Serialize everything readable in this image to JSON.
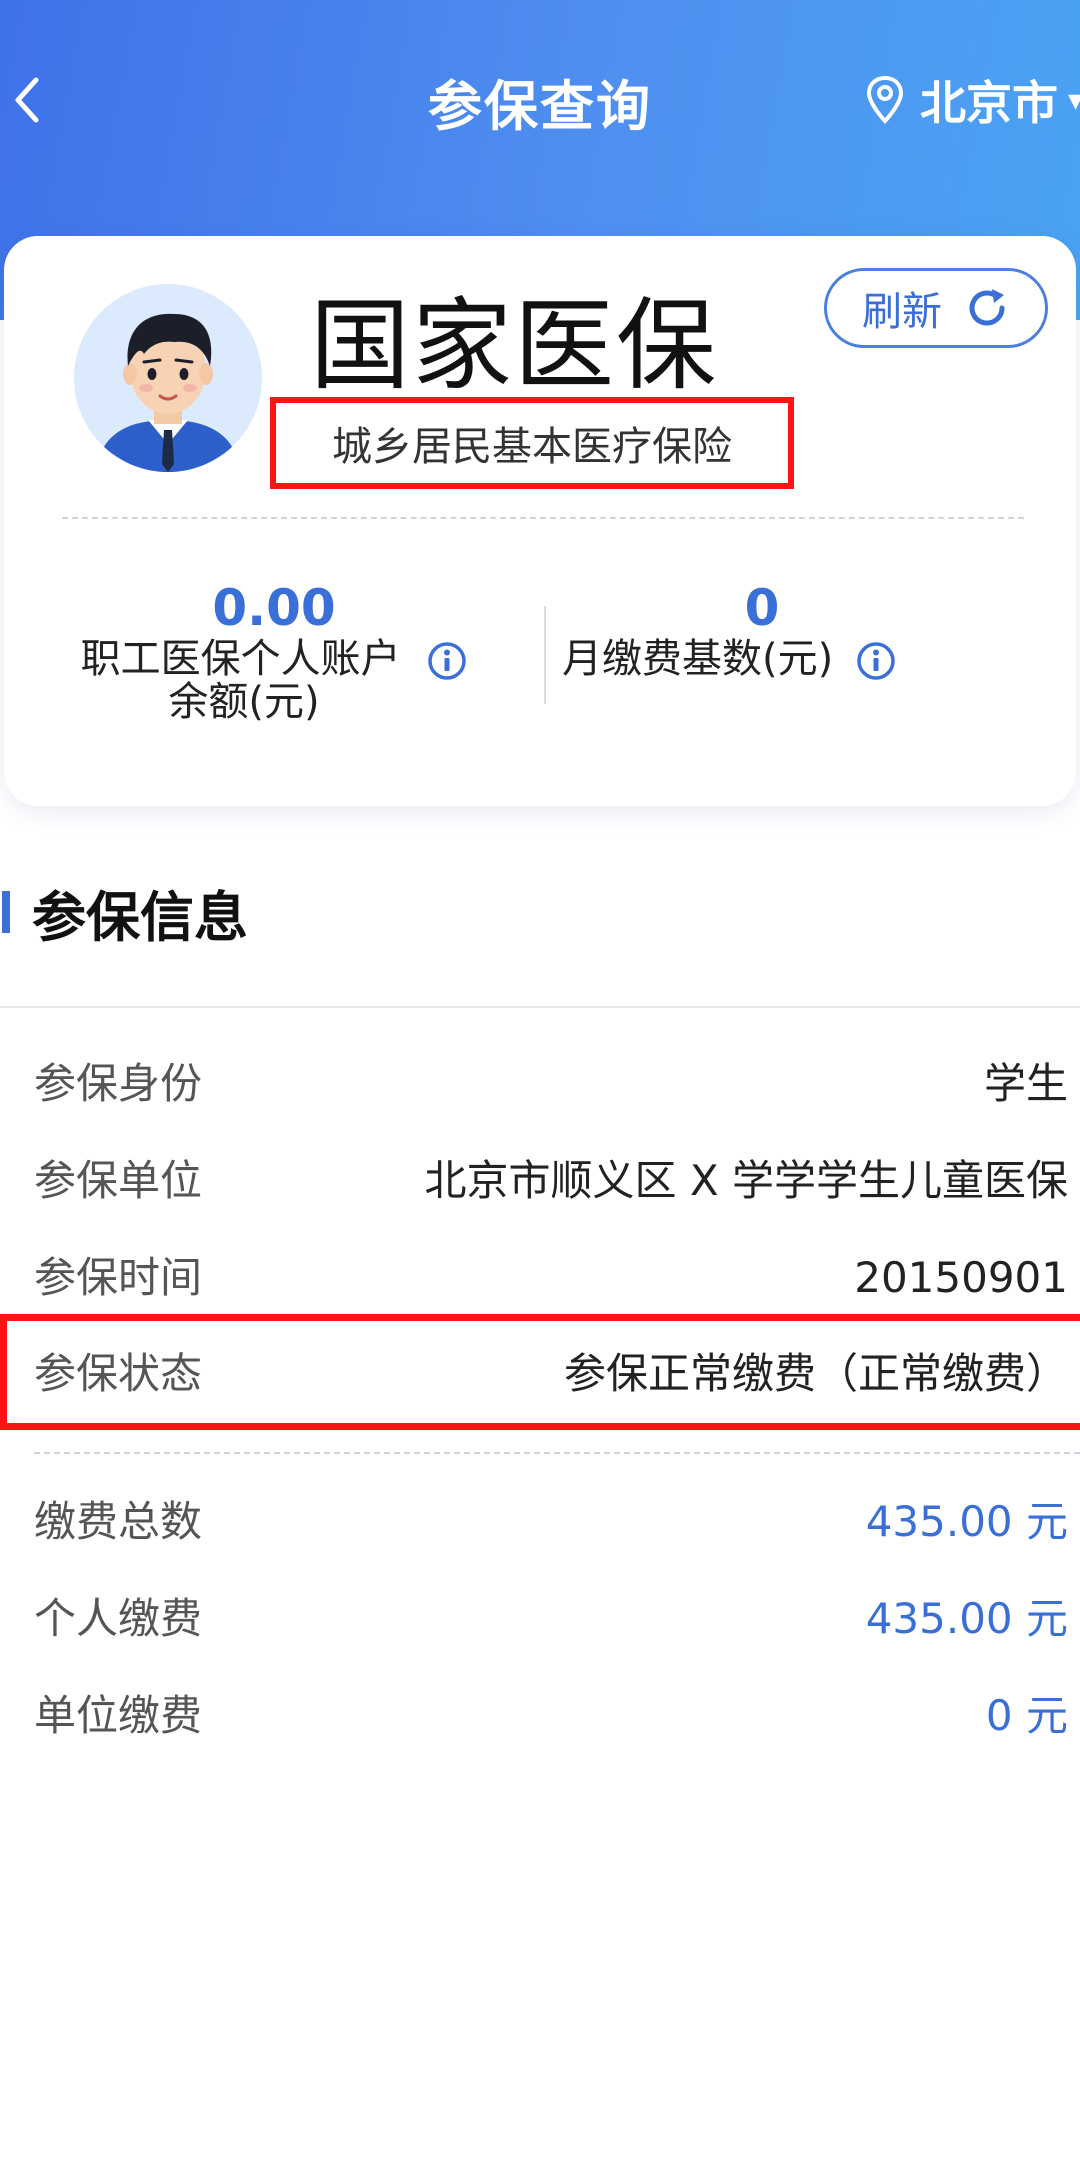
{
  "header": {
    "title": "参保查询",
    "location": "北京市",
    "colors": {
      "gradient_start": "#3f72e8",
      "gradient_end": "#4aa3f4"
    },
    "icons": {
      "back": "chevron-left-icon",
      "location": "location-pin-icon",
      "dropdown": "chevron-down-icon"
    }
  },
  "card": {
    "brand": "国家医保",
    "insurance_type": "城乡居民基本医疗保险",
    "refresh_label": "刷新",
    "stats": [
      {
        "value": "0.00",
        "label_line1": "职工医保个人账户",
        "label_line2": "余额(元)"
      },
      {
        "value": "0",
        "label_line1": "月缴费基数(元)"
      }
    ]
  },
  "section": {
    "title": "参保信息",
    "rows": [
      {
        "label": "参保身份",
        "value": "学生"
      },
      {
        "label": "参保单位",
        "value": "北京市顺义区 X 学学学生儿童医保"
      },
      {
        "label": "参保时间",
        "value": "20150901"
      },
      {
        "label": "参保状态",
        "value": "参保正常缴费（正常缴费）"
      }
    ],
    "payments": [
      {
        "label": "缴费总数",
        "value": "435.00 元"
      },
      {
        "label": "个人缴费",
        "value": "435.00 元"
      },
      {
        "label": "单位缴费",
        "value": "0 元"
      }
    ]
  },
  "accent_color": "#3a6fd8",
  "highlight_color": "#ff1414"
}
